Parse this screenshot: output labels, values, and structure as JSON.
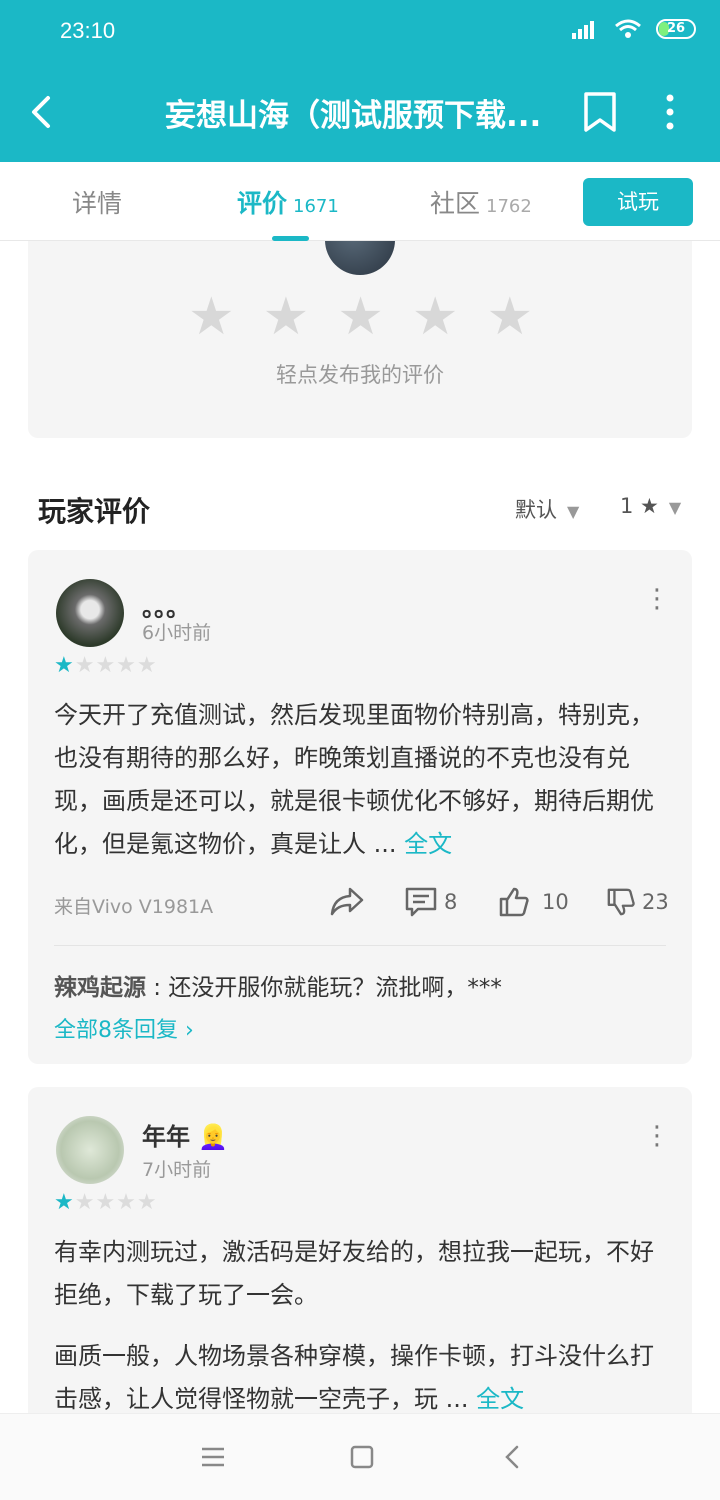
{
  "status": {
    "time": "23:10",
    "battery": "26"
  },
  "header": {
    "title": "妄想山海（测试服预下载..."
  },
  "tabs": [
    {
      "label": "详情",
      "count": ""
    },
    {
      "label": "评价",
      "count": "1671"
    },
    {
      "label": "社区",
      "count": "1762"
    }
  ],
  "trial_button": "试玩",
  "rate_prompt": "轻点发布我的评价",
  "reviews_section": {
    "title": "玩家评价",
    "sort": "默认",
    "filter": "1 ★"
  },
  "reviews": [
    {
      "user": "。。。",
      "time": "6小时前",
      "stars": 1,
      "text": "今天开了充值测试，然后发现里面物价特别高，特别克，也没有期待的那么好，昨晚策划直播说的不克也没有兑现，画质是还可以，就是很卡顿优化不够好，期待后期优化，但是氪这物价，真是让人 ...",
      "full_text_label": "全文",
      "device": "来自Vivo V1981A",
      "comments": "8",
      "likes": "10",
      "dislikes": "23",
      "reply_user": "辣鸡起源",
      "reply_text": " : 还没开服你就能玩？流批啊，***",
      "all_replies": "全部8条回复 ›"
    },
    {
      "user": "年年 👱‍♀️",
      "time": "7小时前",
      "stars": 1,
      "text_p1": "有幸内测玩过，激活码是好友给的，想拉我一起玩，不好拒绝，下载了玩了一会。",
      "text_p2": "画质一般，人物场景各种穿模，操作卡顿，打斗没什么打击感，让人觉得怪物就一空壳子，玩 ...",
      "full_text_label": "全文"
    }
  ],
  "colors": {
    "accent": "#1bb8c6"
  }
}
